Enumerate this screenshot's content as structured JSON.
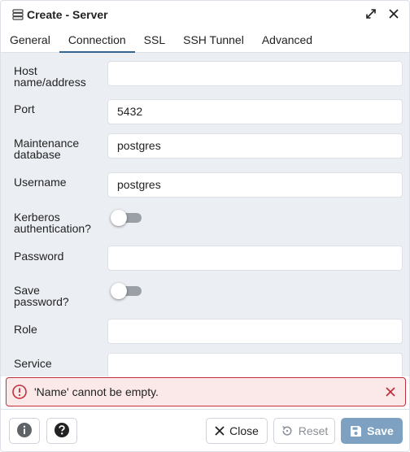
{
  "dialog": {
    "title": "Create - Server",
    "title_icon": "server-icon",
    "actions": [
      "expand-icon",
      "close-icon"
    ]
  },
  "tabs": [
    {
      "label": "General",
      "active": false
    },
    {
      "label": "Connection",
      "active": true
    },
    {
      "label": "SSL",
      "active": false
    },
    {
      "label": "SSH Tunnel",
      "active": false
    },
    {
      "label": "Advanced",
      "active": false
    }
  ],
  "form": {
    "host": {
      "line1": "Host",
      "line2": "name/address",
      "value": ""
    },
    "port": {
      "label": "Port",
      "value": "5432"
    },
    "maintenance_db": {
      "line1": "Maintenance",
      "line2": "database",
      "value": "postgres"
    },
    "username": {
      "label": "Username",
      "value": "postgres"
    },
    "kerberos": {
      "line1": "Kerberos",
      "line2": "authentication?",
      "enabled": false
    },
    "password": {
      "label": "Password",
      "value": ""
    },
    "save_password": {
      "line1": "Save",
      "line2": "password?",
      "enabled": false
    },
    "role": {
      "label": "Role",
      "value": ""
    },
    "service": {
      "label": "Service",
      "value": ""
    }
  },
  "error": {
    "message": "'Name' cannot be empty.",
    "color": "#c1313b"
  },
  "footer": {
    "info_icon": "info-icon",
    "help_icon": "help-icon",
    "close_label": "Close",
    "reset_label": "Reset",
    "save_label": "Save",
    "accent": "#326690",
    "save_color": "#7fa1c1"
  }
}
